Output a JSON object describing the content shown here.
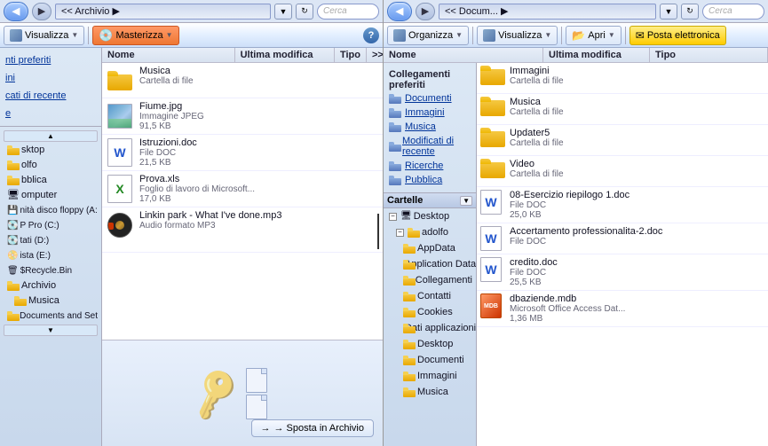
{
  "left": {
    "addressBar": {
      "path": "<< Archivio  ▶",
      "searchPlaceholder": "Cerca"
    },
    "toolbar": {
      "organizzaLabel": "Visualizza",
      "masterizzaLabel": "Masterizza",
      "dropdownChevron": "▼",
      "helpTitle": "?"
    },
    "columns": {
      "name": "Nome",
      "date": "Ultima modifica",
      "type": "Tipo",
      "expand": ">>"
    },
    "sidebar": {
      "items": [
        "nti preferiti",
        "ini",
        "cati di recente",
        "e"
      ],
      "treeItems": [
        {
          "label": "sktop",
          "indent": 0,
          "hasExpand": false
        },
        {
          "label": "olfo",
          "indent": 0,
          "hasExpand": false
        },
        {
          "label": "bblica",
          "indent": 0,
          "hasExpand": false
        },
        {
          "label": "omputer",
          "indent": 0,
          "hasExpand": false
        },
        {
          "label": "nità disco floppy (A:",
          "indent": 0,
          "hasExpand": false
        },
        {
          "label": "P Pro (C:)",
          "indent": 0,
          "hasExpand": false
        },
        {
          "label": "tati (D:)",
          "indent": 0,
          "hasExpand": false
        },
        {
          "label": "ista (E:)",
          "indent": 0,
          "hasExpand": false
        },
        {
          "label": "$Recycle.Bin",
          "indent": 0,
          "hasExpand": false
        },
        {
          "label": "Archivio",
          "indent": 0,
          "hasExpand": false
        },
        {
          "label": "Musica",
          "indent": 1,
          "hasExpand": false
        },
        {
          "label": "Documents and Set",
          "indent": 0,
          "hasExpand": false
        }
      ]
    },
    "files": [
      {
        "name": "Musica",
        "meta": "Cartella di file",
        "type": "folder"
      },
      {
        "name": "Fiume.jpg",
        "meta": "Immagine JPEG\n91,5 KB",
        "type": "jpg"
      },
      {
        "name": "Istruzioni.doc",
        "meta": "File DOC\n21,5 KB",
        "type": "doc"
      },
      {
        "name": "Prova.xls",
        "meta": "Foglio di lavoro di Microsoft...\n17,0 KB",
        "type": "xls"
      },
      {
        "name": "Linkin park - What I've done.mp3",
        "meta": "Audio formato MP3",
        "type": "mp3"
      }
    ],
    "archiveBtn": "→ Sposta in Archivio"
  },
  "right": {
    "addressBar": {
      "path": "<< Docum... ▶",
      "searchPlaceholder": "Cerca"
    },
    "toolbar": {
      "organizzaLabel": "Organizza",
      "visualizzaLabel": "Visualizza",
      "apriLabel": "Apri",
      "postaLabel": "Posta elettronica"
    },
    "columns": {
      "name": "Nome",
      "date": "Ultima modifica",
      "type": "Tipo"
    },
    "favoriteLinks": {
      "title": "Collegamenti preferiti",
      "items": [
        {
          "label": "Documenti",
          "icon": "doc-folder"
        },
        {
          "label": "Immagini",
          "icon": "img-folder"
        },
        {
          "label": "Musica",
          "icon": "music-folder"
        },
        {
          "label": "Modificati di recente",
          "icon": "recent-folder"
        },
        {
          "label": "Ricerche",
          "icon": "search-folder"
        },
        {
          "label": "Pubblica",
          "icon": "pub-folder"
        }
      ]
    },
    "foldersSection": {
      "title": "Cartelle",
      "items": [
        {
          "label": "Desktop",
          "indent": 0,
          "selected": false
        },
        {
          "label": "adolfo",
          "indent": 1,
          "selected": false
        },
        {
          "label": "AppData",
          "indent": 2,
          "selected": false
        },
        {
          "label": "Application Data",
          "indent": 2,
          "selected": false
        },
        {
          "label": "Collegamenti",
          "indent": 2,
          "selected": false
        },
        {
          "label": "Contatti",
          "indent": 2,
          "selected": false
        },
        {
          "label": "Cookies",
          "indent": 2,
          "selected": false
        },
        {
          "label": "Dati applicazioni",
          "indent": 2,
          "selected": false
        },
        {
          "label": "Desktop",
          "indent": 2,
          "selected": false
        },
        {
          "label": "Documenti",
          "indent": 2,
          "selected": false
        },
        {
          "label": "Immagini",
          "indent": 2,
          "selected": false
        },
        {
          "label": "Musica",
          "indent": 2,
          "selected": false
        }
      ]
    },
    "files": [
      {
        "name": "Immagini",
        "meta": "Cartella di file",
        "type": "folder"
      },
      {
        "name": "Musica",
        "meta": "Cartella di file",
        "type": "folder"
      },
      {
        "name": "Updater5",
        "meta": "Cartella di file",
        "type": "folder"
      },
      {
        "name": "Video",
        "meta": "Cartella di file",
        "type": "folder"
      },
      {
        "name": "08-Esercizio riepilogo 1.doc",
        "meta": "File DOC\n25,0 KB",
        "type": "doc"
      },
      {
        "name": "Accertamento professionalita-2.doc",
        "meta": "File DOC",
        "type": "doc"
      },
      {
        "name": "credito.doc",
        "meta": "File DOC\n25,5 KB",
        "type": "doc"
      },
      {
        "name": "dbaziende.mdb",
        "meta": "Microsoft Office Access Dat...\n1,36 MB",
        "type": "mdb"
      }
    ]
  }
}
